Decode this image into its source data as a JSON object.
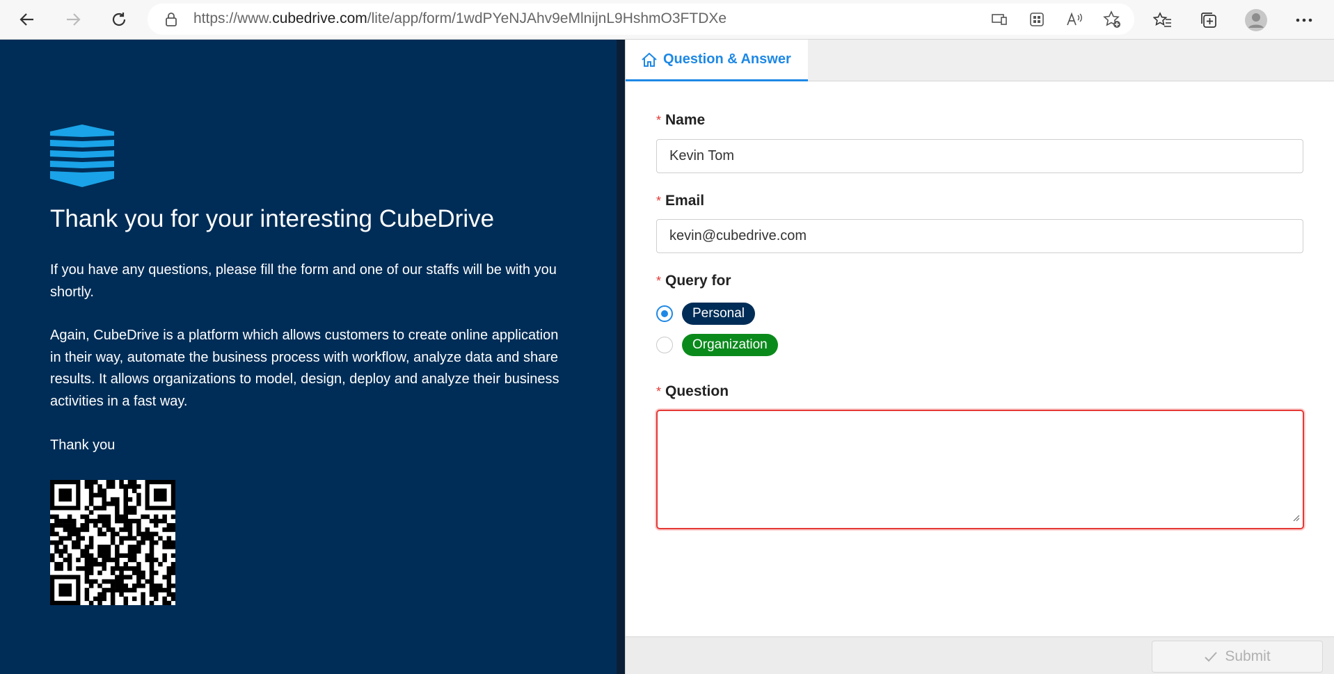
{
  "browser": {
    "url_prefix": "https://www.",
    "url_domain": "cubedrive.com",
    "url_path": "/lite/app/form/1wdPYeNJAhv9eMlnijnL9HshmO3FTDXe",
    "icons": [
      "back-arrow-icon",
      "forward-arrow-icon",
      "refresh-icon",
      "lock-icon",
      "app-available-icon",
      "apps-grid-icon",
      "read-aloud-icon",
      "add-favorite-icon",
      "favorites-icon",
      "collections-icon",
      "profile-icon",
      "more-icon"
    ]
  },
  "left": {
    "title": "Thank you for your interesting CubeDrive",
    "para1": "If you have any questions, please fill the form and one of our staffs will be with you shortly.",
    "para2": "Again, CubeDrive is a platform which allows customers to create online application in their way, automate the business process with workflow, analyze data and share results. It allows organizations to model, design, deploy and analyze their business activities in a fast way.",
    "para3": "Thank you",
    "colors": {
      "background": "#002d57",
      "logo": "#1aa3e8"
    }
  },
  "form": {
    "tab_label": "Question & Answer",
    "required_mark": "*",
    "name_label": "Name",
    "name_value": "Kevin Tom",
    "email_label": "Email",
    "email_value": "kevin@cubedrive.com",
    "query_label": "Query for",
    "options": [
      {
        "label": "Personal",
        "color": "#002d57",
        "selected": true
      },
      {
        "label": "Organization",
        "color": "#0b8a1c",
        "selected": false
      }
    ],
    "question_label": "Question",
    "question_value": "",
    "submit_label": "Submit",
    "accent": "#1e88e5",
    "error_color": "#e53935"
  }
}
